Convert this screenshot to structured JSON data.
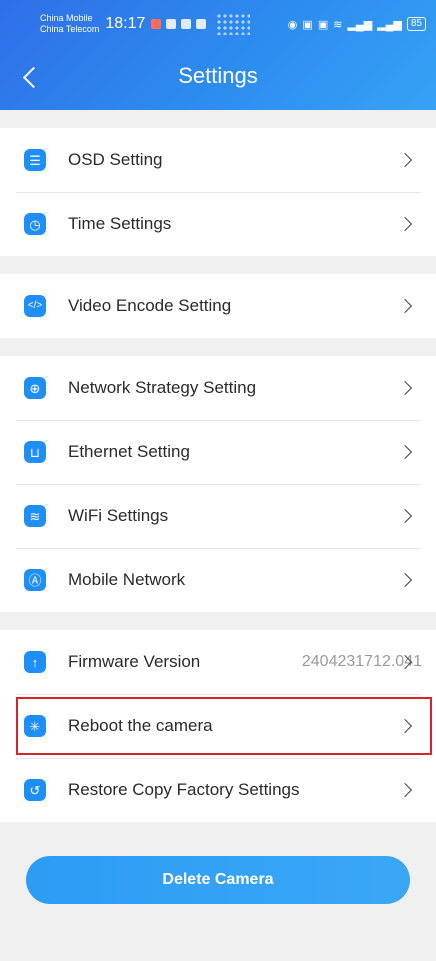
{
  "status_bar": {
    "carrier_1": "China Mobile",
    "carrier_2": "China Telecom",
    "time": "18:17",
    "battery": "85"
  },
  "header": {
    "title": "Settings",
    "back_icon": "chevron-left-icon",
    "background": "#2d8cf0"
  },
  "groups": [
    {
      "items": [
        {
          "label": "OSD Setting",
          "icon": "osd-icon"
        },
        {
          "label": "Time Settings",
          "icon": "clock-icon"
        }
      ]
    },
    {
      "items": [
        {
          "label": "Video Encode Setting",
          "icon": "code-icon"
        }
      ]
    },
    {
      "items": [
        {
          "label": "Network Strategy Setting",
          "icon": "globe-icon"
        },
        {
          "label": "Ethernet Setting",
          "icon": "ethernet-icon"
        },
        {
          "label": "WiFi Settings",
          "icon": "wifi-icon"
        },
        {
          "label": "Mobile Network",
          "icon": "antenna-icon"
        }
      ]
    },
    {
      "items": [
        {
          "label": "Firmware Version",
          "icon": "upgrade-icon",
          "value": "2404231712.041"
        },
        {
          "label": "Reboot the camera",
          "icon": "reboot-icon",
          "highlighted": true
        },
        {
          "label": "Restore Copy Factory Settings",
          "icon": "restore-icon"
        }
      ]
    }
  ],
  "delete_button": {
    "label": "Delete Camera",
    "color": "#3aa7f6"
  },
  "colors": {
    "accent": "#1f8ff7",
    "highlight_border": "#d8232e"
  }
}
